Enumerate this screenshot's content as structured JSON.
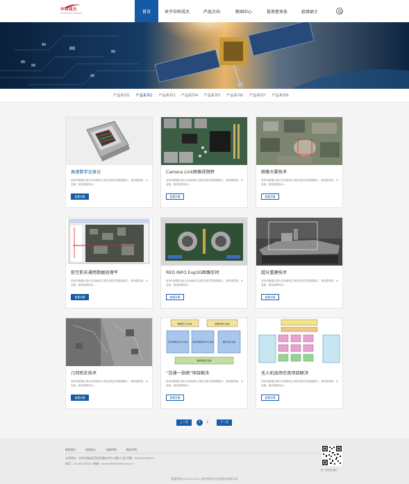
{
  "header": {
    "logo_text": "中科戎大",
    "logo_sub": "ZHONGKE RONGDA"
  },
  "nav": {
    "items": [
      {
        "label": "首页",
        "active": true
      },
      {
        "label": "关于中科戎大",
        "active": false
      },
      {
        "label": "产品方向",
        "active": false
      },
      {
        "label": "新闻中心",
        "active": false
      },
      {
        "label": "投资者关系",
        "active": false
      },
      {
        "label": "招贤纳士",
        "active": false
      }
    ],
    "search_icon": "search-icon"
  },
  "subnav": {
    "items": [
      {
        "label": "产品系列1",
        "active": false
      },
      {
        "label": "产品系列2",
        "active": true
      },
      {
        "label": "产品系列3",
        "active": false
      },
      {
        "label": "产品系列4",
        "active": false
      },
      {
        "label": "产品系列5",
        "active": false
      },
      {
        "label": "产品系列6",
        "active": false
      },
      {
        "label": "产品系列7",
        "active": false
      },
      {
        "label": "产品系列8",
        "active": false
      }
    ]
  },
  "products": [
    {
      "title": "高速数字记录仪",
      "desc": "该系列数据记录仪支持各种主流的过程式的数据接口，具有高带宽，大容量，高性能等特点...",
      "button": "查看详情"
    },
    {
      "title": "Camera Link图像视频转",
      "desc": "该系列数据记录仪支持各种主流的过程式的数据接口，具有高带宽，大容量，高性能等特点...",
      "button": "查看详情"
    },
    {
      "title": "图像大雾技术",
      "desc": "该系列数据记录仪支持各种主流的过程式的数据接口，具有高带宽，大容量，高性能等特点...",
      "button": "查看详情"
    },
    {
      "title": "航空航天通用数据处理平",
      "desc": "该系列数据记录仪支持各种主流的过程式的数据接口，具有高带宽，大容量，高性能等特点...",
      "button": "查看详情"
    },
    {
      "title": "RED INFO Exp3G图像实时",
      "desc": "该系列数据记录仪支持各种主流的过程式的数据接口，具有高带宽，大容量，高性能等特点...",
      "button": "查看详情"
    },
    {
      "title": "超分重建技术",
      "desc": "该系列数据记录仪支持各种主流的过程式的数据接口，具有高带宽，大容量，高性能等特点...",
      "button": "查看详情"
    },
    {
      "title": "几何校正技术",
      "desc": "该系列数据记录仪支持各种主流的过程式的数据接口，具有高带宽，大容量，高性能等特点...",
      "button": "查看详情"
    },
    {
      "title": "“交通一张图”项目解决",
      "desc": "该系列数据记录仪支持各种主流的过程式的数据接口，具有高带宽，大容量，高性能等特点...",
      "button": "查看详情"
    },
    {
      "title": "无人机战场仿真项目解决",
      "desc": "该系列数据记录仪支持各种主流的过程式的数据接口，具有高带宽，大容量，高性能等特点...",
      "button": "查看详情"
    }
  ],
  "diagram_b": {
    "top": "数据接口子系统",
    "top2": "数据处理子系统",
    "m1": "该系列数据记录仪子系统",
    "m2": "交通局数据服务IPE子系统",
    "m3": "数据存储子系统",
    "bottom": "数据管理子系统"
  },
  "pager": {
    "prev": "上一页",
    "pages": [
      "1",
      "2"
    ],
    "next": "下一页"
  },
  "footer": {
    "links": [
      "联系我们",
      "招贤纳士",
      "法律声明",
      "隐私声明"
    ],
    "line1": "公司地址：北京市海淀区西北旺路66号D-3楼201室    传真：010-82156101",
    "line2": "电话：010-82156101    邮箱：service@redinfo.com.cn",
    "qr_caption": "扫一扫关注我们",
    "copyright": "版权所有(C)2004-2012 北京中科戎大信息技术有限公司"
  },
  "colors": {
    "brand_blue": "#1659a6",
    "logo_red": "#c0282d"
  }
}
